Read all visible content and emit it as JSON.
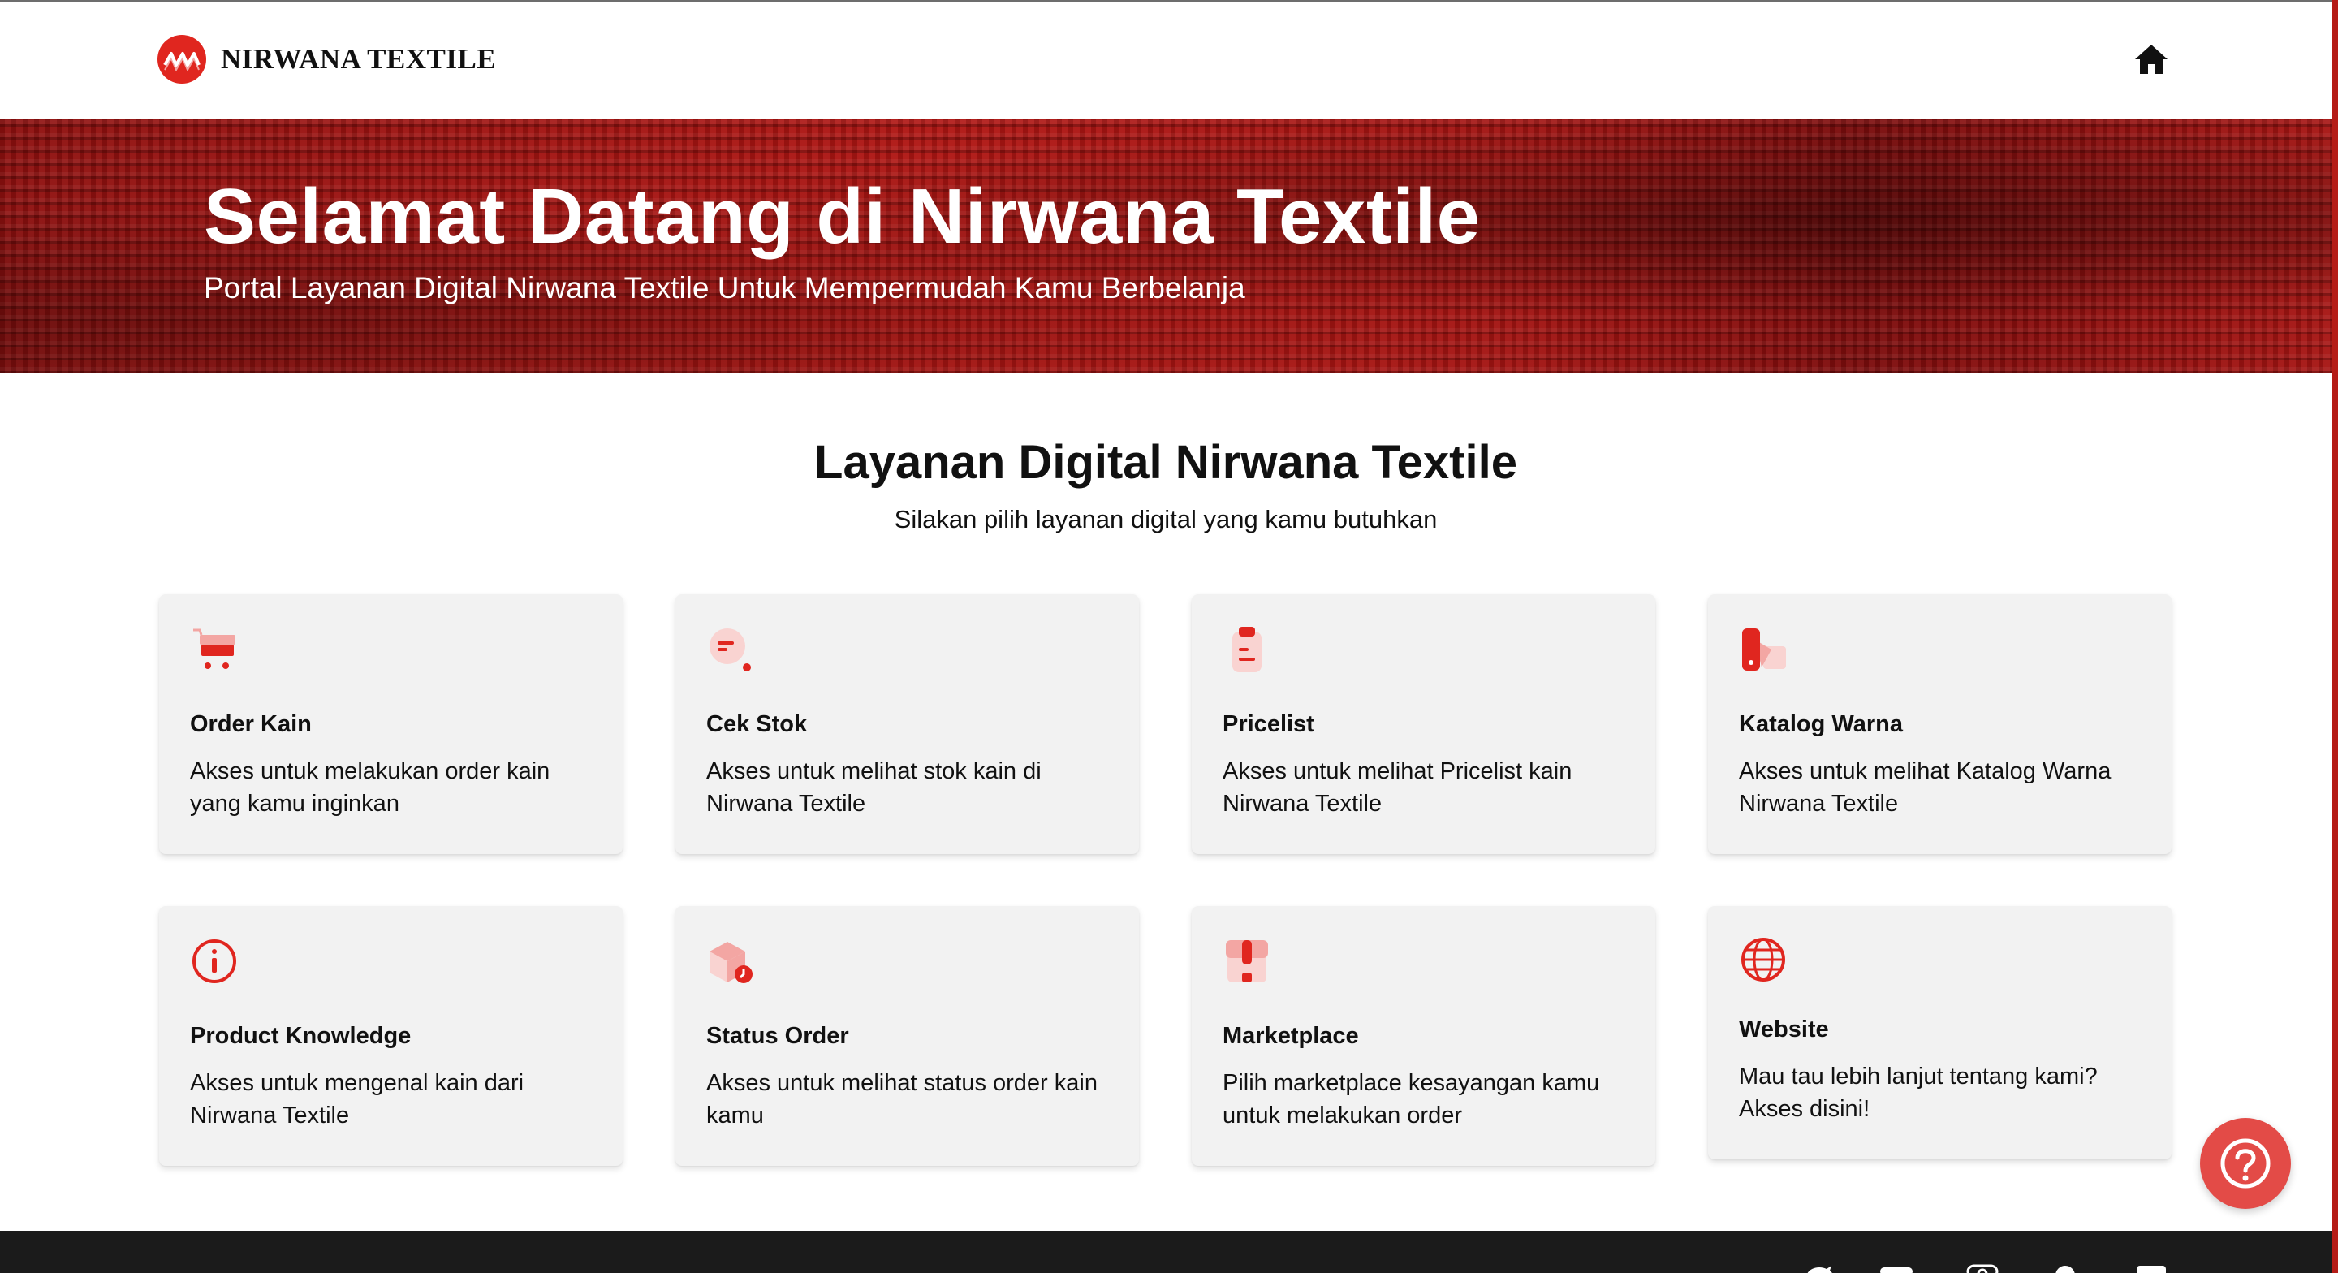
{
  "brand": {
    "name": "NIRWANA TEXTILE",
    "accent": "#e0261f"
  },
  "nav": {
    "home_icon": "home-icon"
  },
  "hero": {
    "title": "Selamat Datang di Nirwana Textile",
    "subtitle": "Portal Layanan Digital Nirwana Textile Untuk Mempermudah Kamu Berbelanja"
  },
  "section": {
    "title": "Layanan Digital Nirwana Textile",
    "subtitle": "Silakan pilih layanan digital yang kamu butuhkan"
  },
  "cards": [
    {
      "title": "Order Kain",
      "desc": "Akses untuk melakukan order kain yang kamu inginkan",
      "icon": "cart-icon"
    },
    {
      "title": "Cek Stok",
      "desc": "Akses untuk melihat stok kain di Nirwana Textile",
      "icon": "search-stock-icon"
    },
    {
      "title": "Pricelist",
      "desc": "Akses untuk melihat Pricelist kain Nirwana Textile",
      "icon": "pricelist-icon"
    },
    {
      "title": "Katalog Warna",
      "desc": "Akses untuk melihat Katalog Warna Nirwana Textile",
      "icon": "color-swatch-icon"
    },
    {
      "title": "Product Knowledge",
      "desc": "Akses untuk mengenal kain dari Nirwana Textile",
      "icon": "info-icon"
    },
    {
      "title": "Status Order",
      "desc": "Akses untuk melihat status order kain kamu",
      "icon": "package-status-icon"
    },
    {
      "title": "Marketplace",
      "desc": "Pilih marketplace kesayangan kamu untuk melakukan order",
      "icon": "store-icon"
    },
    {
      "title": "Website",
      "desc": "Mau tau lebih lanjut tentang kami? Akses disini!",
      "icon": "globe-icon"
    }
  ],
  "help": {
    "icon": "help-icon"
  },
  "footer": {
    "social_icons": [
      "twitter-icon",
      "youtube-icon",
      "instagram-icon",
      "pinterest-icon",
      "facebook-icon"
    ]
  }
}
